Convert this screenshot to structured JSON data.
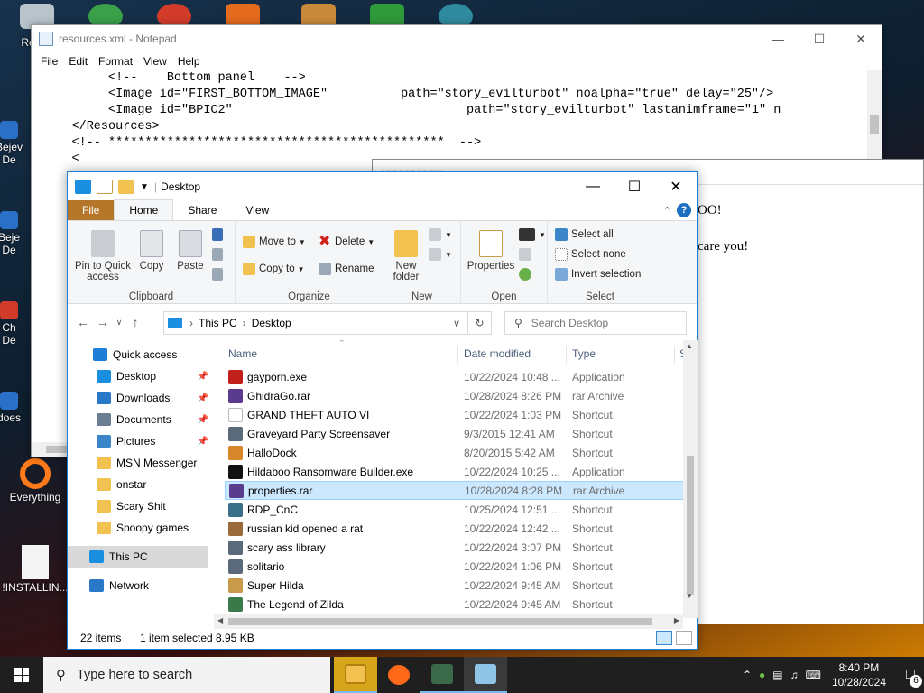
{
  "desktop": {
    "icons": [
      {
        "label": "Recy"
      },
      {
        "label": "Bejev\nDe"
      },
      {
        "label": "Beje\nDe"
      },
      {
        "label": "Ch\nDe"
      },
      {
        "label": "does"
      },
      {
        "label": "Everything"
      },
      {
        "label": "!INSTALLIN..."
      }
    ]
  },
  "notepad": {
    "title": "resources.xml - Notepad",
    "menu": [
      "File",
      "Edit",
      "Format",
      "View",
      "Help"
    ],
    "lines": [
      "          <!--    Bottom panel    -->",
      "          <Image id=\"FIRST_BOTTOM_IMAGE\"          path=\"story_evilturbot\" noalpha=\"true\" delay=\"25\"/>",
      "          <Image id=\"BPIC2\"                                path=\"story_evilturbot\" lastanimframe=\"1\" n",
      "     </Resources>",
      "",
      "     <!-- **********************************************  -->",
      "     <"
    ]
  },
  "dialog": {
    "title": "ooooooooow",
    "line1": "OO!",
    "line2": "care you!"
  },
  "explorer": {
    "title": "Desktop",
    "tabs": [
      "File",
      "Home",
      "Share",
      "View"
    ],
    "help": "?",
    "ribbon": {
      "clipboard": {
        "pin": "Pin to Quick access",
        "copy": "Copy",
        "paste": "Paste",
        "name": "Clipboard"
      },
      "organize": {
        "move_to": "Move to",
        "copy_to": "Copy to",
        "delete": "Delete",
        "rename": "Rename",
        "name": "Organize"
      },
      "new": {
        "new_folder": "New folder",
        "name": "New"
      },
      "open": {
        "properties": "Properties",
        "name": "Open"
      },
      "select": {
        "select_all": "Select all",
        "select_none": "Select none",
        "invert": "Invert selection",
        "name": "Select"
      }
    },
    "address": {
      "segments": [
        "This PC",
        "Desktop"
      ],
      "search_placeholder": "Search Desktop"
    },
    "nav": [
      {
        "label": "Quick access",
        "pinned": false,
        "color": "#1e7fd6"
      },
      {
        "label": "Desktop",
        "pinned": true,
        "color": "#1a8fe0"
      },
      {
        "label": "Downloads",
        "pinned": true,
        "color": "#2a78c8"
      },
      {
        "label": "Documents",
        "pinned": true,
        "color": "#6a7d92"
      },
      {
        "label": "Pictures",
        "pinned": true,
        "color": "#3a86c9"
      },
      {
        "label": "MSN Messenger",
        "pinned": false,
        "color": "#f2c250"
      },
      {
        "label": "onstar",
        "pinned": false,
        "color": "#f2c250"
      },
      {
        "label": "Scary Shit",
        "pinned": false,
        "color": "#f2c250"
      },
      {
        "label": "Spoopy games",
        "pinned": false,
        "color": "#f2c250"
      },
      {
        "label": "This PC",
        "pinned": false,
        "color": "#1a8fe0"
      },
      {
        "label": "Network",
        "pinned": false,
        "color": "#2a78c8"
      }
    ],
    "columns": {
      "name": "Name",
      "date": "Date modified",
      "type": "Type",
      "size": "S"
    },
    "files": [
      {
        "name": "gayporn.exe",
        "date": "10/22/2024 10:48 ...",
        "type": "Application",
        "color": "#c2201a"
      },
      {
        "name": "GhidraGo.rar",
        "date": "10/28/2024 8:26 PM",
        "type": "rar Archive",
        "color": "#5a3c8e"
      },
      {
        "name": "GRAND THEFT AUTO VI",
        "date": "10/22/2024 1:03 PM",
        "type": "Shortcut",
        "color": "#ffffff"
      },
      {
        "name": "Graveyard Party Screensaver",
        "date": "9/3/2015 12:41 AM",
        "type": "Shortcut",
        "color": "#5a6a7a"
      },
      {
        "name": "HalloDock",
        "date": "8/20/2015 5:42 AM",
        "type": "Shortcut",
        "color": "#d8862a"
      },
      {
        "name": "Hildaboo Ransomware Builder.exe",
        "date": "10/22/2024 10:25 ...",
        "type": "Application",
        "color": "#111111"
      },
      {
        "name": "properties.rar",
        "date": "10/28/2024 8:28 PM",
        "type": "rar Archive",
        "color": "#5a3c8e"
      },
      {
        "name": "RDP_CnC",
        "date": "10/25/2024 12:51 ...",
        "type": "Shortcut",
        "color": "#3a6f8a"
      },
      {
        "name": "russian kid opened a rat",
        "date": "10/22/2024 12:42 ...",
        "type": "Shortcut",
        "color": "#9a6a3a"
      },
      {
        "name": "scary ass library",
        "date": "10/22/2024 3:07 PM",
        "type": "Shortcut",
        "color": "#5a6a7a"
      },
      {
        "name": "solitario",
        "date": "10/22/2024 1:06 PM",
        "type": "Shortcut",
        "color": "#5a6a7a"
      },
      {
        "name": "Super Hilda",
        "date": "10/22/2024 9:45 AM",
        "type": "Shortcut",
        "color": "#c89a4a"
      },
      {
        "name": "The Legend of Zilda",
        "date": "10/22/2024 9:45 AM",
        "type": "Shortcut",
        "color": "#3a7a4a"
      }
    ],
    "selected_index": 6,
    "status": {
      "count": "22 items",
      "selection": "1 item selected",
      "size": "8.95 KB"
    }
  },
  "taskbar": {
    "search_placeholder": "Type here to search",
    "time": "8:40 PM",
    "date": "10/28/2024",
    "notifications": "6"
  }
}
